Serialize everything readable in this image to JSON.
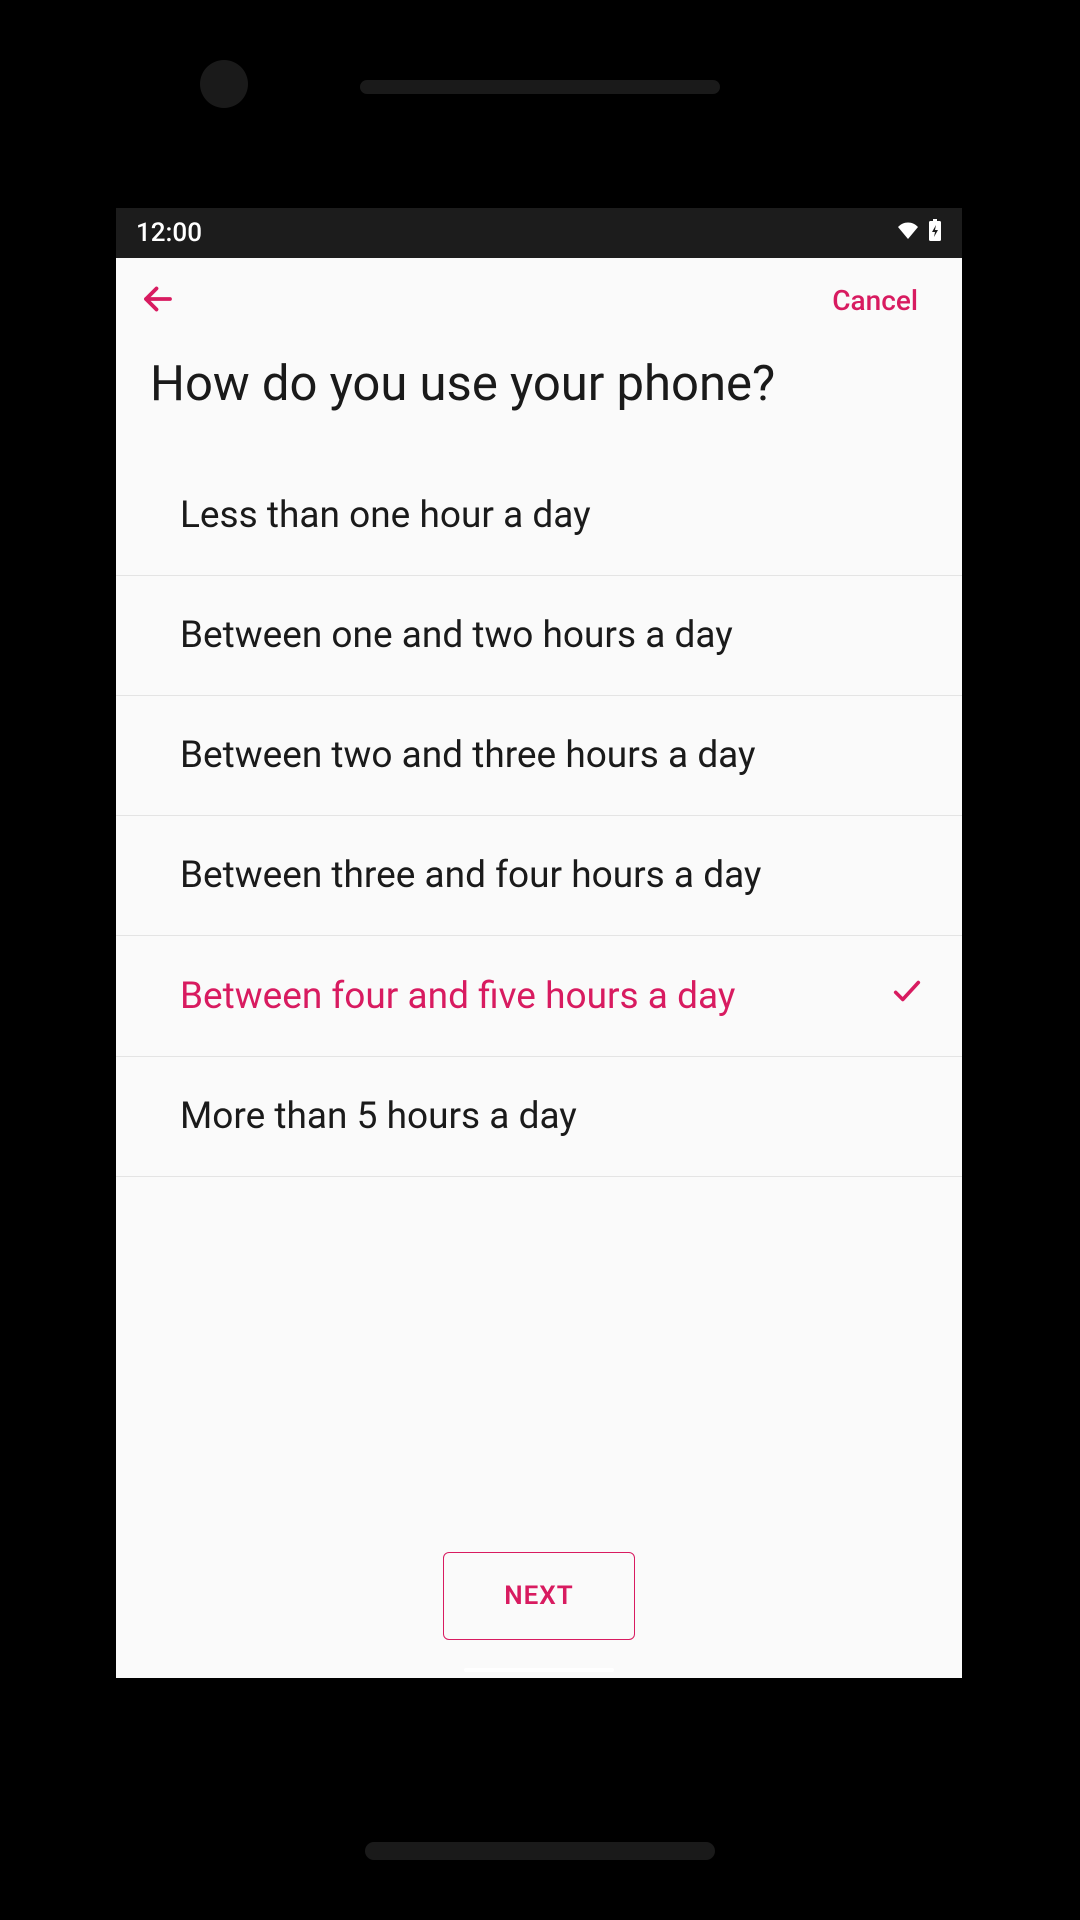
{
  "status_bar": {
    "time": "12:00"
  },
  "header": {
    "cancel_label": "Cancel"
  },
  "page": {
    "title": "How do you use your phone?"
  },
  "options": [
    {
      "label": "Less than one hour a day",
      "selected": false
    },
    {
      "label": "Between one and two hours a day",
      "selected": false
    },
    {
      "label": "Between two and three hours a day",
      "selected": false
    },
    {
      "label": "Between three and four hours a day",
      "selected": false
    },
    {
      "label": "Between four and five hours a day",
      "selected": true
    },
    {
      "label": "More than 5 hours a day",
      "selected": false
    }
  ],
  "footer": {
    "next_label": "NEXT"
  },
  "colors": {
    "accent": "#d81b60"
  }
}
